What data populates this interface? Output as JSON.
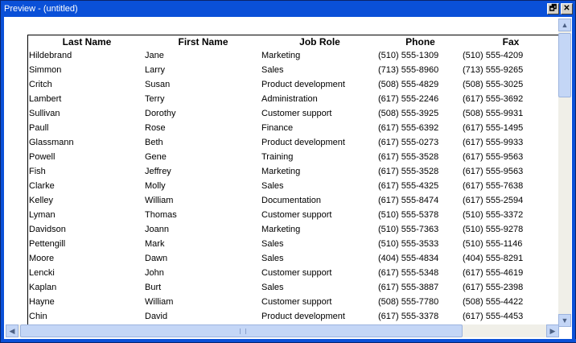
{
  "window": {
    "title": "Preview - (untitled)",
    "restore_glyph": "🗗",
    "close_glyph": "✕"
  },
  "table": {
    "headers": [
      "Last Name",
      "First Name",
      "Job Role",
      "Phone",
      "Fax"
    ],
    "rows": [
      [
        "Hildebrand",
        "Jane",
        "Marketing",
        "(510) 555-1309",
        "(510) 555-4209"
      ],
      [
        "Simmon",
        "Larry",
        "Sales",
        "(713) 555-8960",
        "(713) 555-9265"
      ],
      [
        "Critch",
        "Susan",
        "Product development",
        "(508) 555-4829",
        "(508) 555-3025"
      ],
      [
        "Lambert",
        "Terry",
        "Administration",
        "(617) 555-2246",
        "(617) 555-3692"
      ],
      [
        "Sullivan",
        "Dorothy",
        "Customer support",
        "(508) 555-3925",
        "(508) 555-9931"
      ],
      [
        "Paull",
        "Rose",
        "Finance",
        "(617) 555-6392",
        "(617) 555-1495"
      ],
      [
        "Glassmann",
        "Beth",
        "Product development",
        "(617) 555-0273",
        "(617) 555-9933"
      ],
      [
        "Powell",
        "Gene",
        "Training",
        "(617) 555-3528",
        "(617) 555-9563"
      ],
      [
        "Fish",
        "Jeffrey",
        "Marketing",
        "(617) 555-3528",
        "(617) 555-9563"
      ],
      [
        "Clarke",
        "Molly",
        "Sales",
        "(617) 555-4325",
        "(617) 555-7638"
      ],
      [
        "Kelley",
        "William",
        "Documentation",
        "(617) 555-8474",
        "(617) 555-2594"
      ],
      [
        "Lyman",
        "Thomas",
        "Customer support",
        "(510) 555-5378",
        "(510) 555-3372"
      ],
      [
        "Davidson",
        "Joann",
        "Marketing",
        "(510) 555-7363",
        "(510) 555-9278"
      ],
      [
        "Pettengill",
        "Mark",
        "Sales",
        "(510) 555-3533",
        "(510) 555-1146"
      ],
      [
        "Moore",
        "Dawn",
        "Sales",
        "(404) 555-4834",
        "(404) 555-8291"
      ],
      [
        "Lencki",
        "John",
        "Customer support",
        "(617) 555-5348",
        "(617) 555-4619"
      ],
      [
        "Kaplan",
        "Burt",
        "Sales",
        "(617) 555-3887",
        "(617) 555-2398"
      ],
      [
        "Hayne",
        "William",
        "Customer support",
        "(508) 555-7780",
        "(508) 555-4422"
      ],
      [
        "Chin",
        "David",
        "Product development",
        "(617) 555-3378",
        "(617) 555-4453"
      ]
    ]
  },
  "colors": {
    "titlebar": "#0a50d8",
    "scrollbar_thumb": "#c4d6f6"
  },
  "icons": {
    "scroll_up": "▲",
    "scroll_down": "▼",
    "scroll_left": "◀",
    "scroll_right": "▶"
  }
}
